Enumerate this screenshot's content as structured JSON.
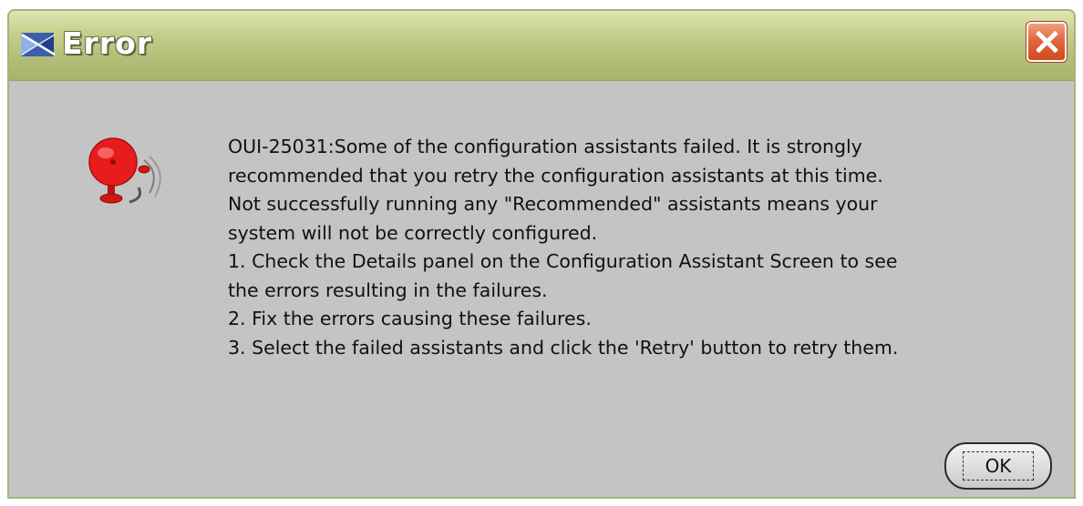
{
  "window": {
    "title": "Error",
    "app_icon": "oracle-installer-icon",
    "close_icon": "close-icon"
  },
  "message": {
    "icon": "alarm-bell-icon",
    "lines": [
      "OUI-25031:Some of the configuration assistants failed. It is strongly",
      "recommended that you retry the configuration assistants at this time.",
      "Not successfully running any \"Recommended\" assistants means your",
      "system will not be correctly configured.",
      "1. Check the Details panel on the Configuration Assistant Screen to see",
      "the errors resulting in the failures.",
      "2. Fix the errors causing these failures.",
      "3. Select the failed assistants and click the 'Retry' button to retry them."
    ]
  },
  "buttons": {
    "ok_label": "OK"
  },
  "colors": {
    "titlebar": "#b6bf79",
    "body": "#c4c4c4",
    "close_button": "#e2673d",
    "bell": "#e81c1c"
  }
}
